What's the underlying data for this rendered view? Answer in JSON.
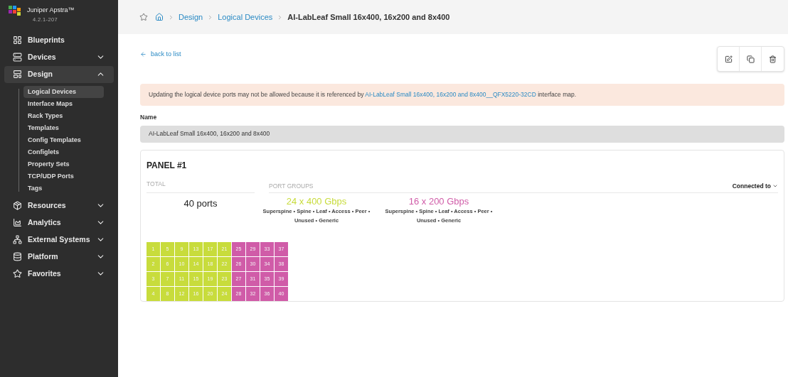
{
  "app": {
    "name": "Juniper Apstra™",
    "version": "4.2.1-207"
  },
  "nav": [
    {
      "label": "Blueprints",
      "kind": "link",
      "selected": false
    },
    {
      "label": "Devices",
      "kind": "group",
      "selected": false,
      "expanded": false
    },
    {
      "label": "Design",
      "kind": "group",
      "selected": true,
      "expanded": true,
      "children": [
        {
          "label": "Logical Devices",
          "selected": true
        },
        {
          "label": "Interface Maps",
          "selected": false
        },
        {
          "label": "Rack Types",
          "selected": false
        },
        {
          "label": "Templates",
          "selected": false
        },
        {
          "label": "Config Templates",
          "selected": false
        },
        {
          "label": "Configlets",
          "selected": false
        },
        {
          "label": "Property Sets",
          "selected": false
        },
        {
          "label": "TCP/UDP Ports",
          "selected": false
        },
        {
          "label": "Tags",
          "selected": false
        }
      ]
    },
    {
      "label": "Resources",
      "kind": "group",
      "selected": false,
      "expanded": false
    },
    {
      "label": "Analytics",
      "kind": "group",
      "selected": false,
      "expanded": false
    },
    {
      "label": "External Systems",
      "kind": "group",
      "selected": false,
      "expanded": false
    },
    {
      "label": "Platform",
      "kind": "group",
      "selected": false,
      "expanded": false
    },
    {
      "label": "Favorites",
      "kind": "group",
      "selected": false,
      "expanded": false
    }
  ],
  "breadcrumb": [
    "Design",
    "Logical Devices",
    "AI-LabLeaf Small 16x400, 16x200 and 8x400"
  ],
  "back_link": "back to list",
  "warning": "Updating the logical device ports may not be allowed because it is referenced by ",
  "warning_link": "AI-LabLeaf Small 16x400, 16x200 and 8x400__QFX5220-32CD",
  "warning_tail": " interface map.",
  "name_label": "Name",
  "name_value": "AI-LabLeaf Small 16x400, 16x200 and 8x400",
  "panel": {
    "title": "PANEL #1",
    "total_label": "TOTAL",
    "groups_label": "PORT GROUPS",
    "connected_label": "Connected to",
    "total": "40 ports",
    "port_groups": [
      {
        "speed": "24 x 400 Gbps",
        "roles": "Superspine • Spine • Leaf • Access • Peer • Unused • Generic",
        "color": "#c8dc3c"
      },
      {
        "speed": "16 x 200 Gbps",
        "roles": "Superspine • Spine • Leaf • Access • Peer • Unused • Generic",
        "color": "#d05ca8"
      }
    ],
    "ports": [
      {
        "label": "1",
        "color": "#c8dc3c"
      },
      {
        "label": "2",
        "color": "#c8dc3c"
      },
      {
        "label": "3",
        "color": "#c8dc3c"
      },
      {
        "label": "4",
        "color": "#c8dc3c"
      },
      {
        "label": "5",
        "color": "#c8dc3c"
      },
      {
        "label": "6",
        "color": "#c8dc3c"
      },
      {
        "label": "7",
        "color": "#c8dc3c"
      },
      {
        "label": "8",
        "color": "#c8dc3c"
      },
      {
        "label": "9",
        "color": "#c8dc3c"
      },
      {
        "label": "10",
        "color": "#c8dc3c"
      },
      {
        "label": "11",
        "color": "#c8dc3c"
      },
      {
        "label": "12",
        "color": "#c8dc3c"
      },
      {
        "label": "13",
        "color": "#c8dc3c"
      },
      {
        "label": "14",
        "color": "#c8dc3c"
      },
      {
        "label": "15",
        "color": "#c8dc3c"
      },
      {
        "label": "16",
        "color": "#c8dc3c"
      },
      {
        "label": "17",
        "color": "#c8dc3c"
      },
      {
        "label": "18",
        "color": "#c8dc3c"
      },
      {
        "label": "19",
        "color": "#c8dc3c"
      },
      {
        "label": "20",
        "color": "#c8dc3c"
      },
      {
        "label": "21",
        "color": "#c8dc3c"
      },
      {
        "label": "22",
        "color": "#c8dc3c"
      },
      {
        "label": "23",
        "color": "#c8dc3c"
      },
      {
        "label": "24",
        "color": "#c8dc3c"
      },
      {
        "label": "25",
        "color": "#d05ca8"
      },
      {
        "label": "26",
        "color": "#d05ca8"
      },
      {
        "label": "27",
        "color": "#d05ca8"
      },
      {
        "label": "28",
        "color": "#d05ca8"
      },
      {
        "label": "29",
        "color": "#d05ca8"
      },
      {
        "label": "30",
        "color": "#d05ca8"
      },
      {
        "label": "31",
        "color": "#d05ca8"
      },
      {
        "label": "32",
        "color": "#d05ca8"
      },
      {
        "label": "33",
        "color": "#d05ca8"
      },
      {
        "label": "34",
        "color": "#d05ca8"
      },
      {
        "label": "35",
        "color": "#d05ca8"
      },
      {
        "label": "36",
        "color": "#d05ca8"
      },
      {
        "label": "37",
        "color": "#d05ca8"
      },
      {
        "label": "38",
        "color": "#d05ca8"
      },
      {
        "label": "39",
        "color": "#d05ca8"
      },
      {
        "label": "40",
        "color": "#d05ca8"
      }
    ]
  }
}
